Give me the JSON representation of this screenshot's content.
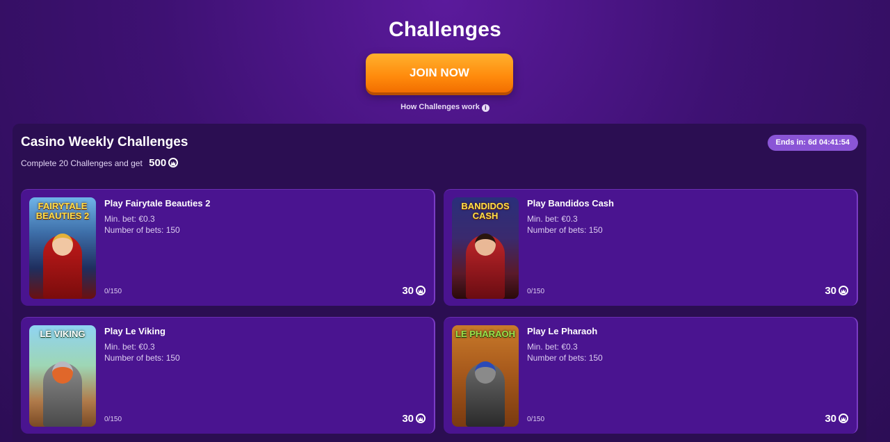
{
  "header": {
    "title": "Challenges",
    "join_label": "JOIN NOW",
    "how_label": "How Challenges work"
  },
  "panel": {
    "title": "Casino Weekly Challenges",
    "subtitle": "Complete 20 Challenges and get",
    "reward": "500",
    "ends_badge": "Ends in: 6d 04:41:54"
  },
  "cards": [
    {
      "title": "Play Fairytale Beauties 2",
      "min_bet": "Min. bet: €0.3",
      "num_bets": "Number of bets: 150",
      "progress": "0/150",
      "points": "30",
      "thumb_label": "FAIRYTALE BEAUTIES 2"
    },
    {
      "title": "Play Bandidos Cash",
      "min_bet": "Min. bet: €0.3",
      "num_bets": "Number of bets: 150",
      "progress": "0/150",
      "points": "30",
      "thumb_label": "BANDIDOS CASH"
    },
    {
      "title": "Play Le Viking",
      "min_bet": "Min. bet: €0.3",
      "num_bets": "Number of bets: 150",
      "progress": "0/150",
      "points": "30",
      "thumb_label": "LE VIKING"
    },
    {
      "title": "Play Le Pharaoh",
      "min_bet": "Min. bet: €0.3",
      "num_bets": "Number of bets: 150",
      "progress": "0/150",
      "points": "30",
      "thumb_label": "LE PHARAOH"
    }
  ],
  "colors": {
    "accent_orange": "#ff8a0c",
    "badge_purple": "#8a55d6",
    "card_bg": "#4a1490",
    "panel_bg": "#2b0e52"
  }
}
